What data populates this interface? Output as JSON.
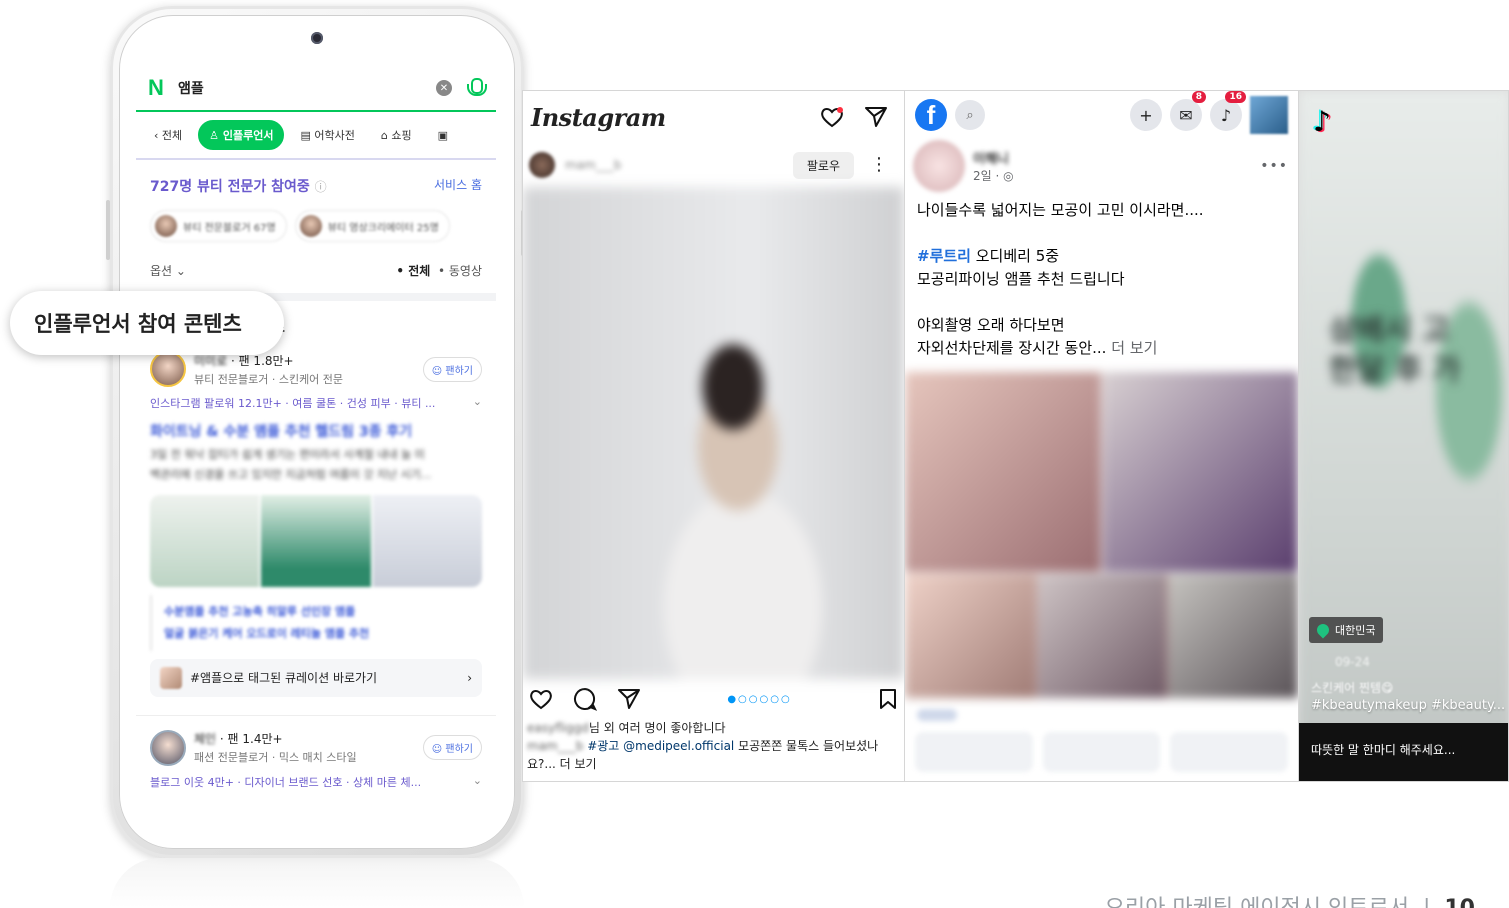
{
  "naver": {
    "query": "앰플",
    "tabs": [
      "전체",
      "인플루언서",
      "어학사전",
      "쇼핑"
    ],
    "stats_title": "727명 뷰티 전문가 참여중",
    "service_home": "서비스 홈",
    "chips": [
      "뷰티 전문블로거 67명",
      "뷰티 영상크리에이터 25명"
    ],
    "options_label": "옵션",
    "filter_all": "• 전체",
    "filter_video": "• 동영상",
    "section_title_suffix": "츠",
    "profile1": {
      "fans": "· 팬 1.8만+",
      "sub": "뷰티 전문블로거 · 스킨케어 전문",
      "fan_button": "☺ 팬하기",
      "tags": "인스타그램 팔로워 12.1만+ · 여름 쿨톤 · 건성 피부 · 뷰티 ..."
    },
    "post_title": "화이트닝 & 수분 앰플 추천 헬드림 3종 후기",
    "post_body": [
      "3일 전 워낙 잡티가 쉽게 생기는 편이라서 사계절 내내 늘 미",
      "백관리에 신경을 쓰고 있지만 지금처럼 여름이 갓 지난 시기..."
    ],
    "related_links": [
      "수분앰플 추천 고농축 히알루 선인장 앰플",
      "얼굴 붉은기 케어 오드로이 레티놀 앰플 추천"
    ],
    "curation": "#앰플으로 태그된 큐레이션 바로가기",
    "profile2": {
      "fans": "· 팬 1.4만+",
      "sub": "패션 전문블로거 · 믹스 매치 스타일",
      "fan_button": "☺ 팬하기",
      "tags": "블로그 이웃 4만+ · 디자이너 브랜드 선호 · 상체 마른 체..."
    }
  },
  "callout": "인플루언서 참여 콘텐츠",
  "instagram": {
    "logo": "Instagram",
    "follow": "팔로우",
    "likes": "님 외 여러 명이 좋아합니다",
    "caption_tag": "#광고 @medipeel.official",
    "caption_text": " 모공쫀쫀 물톡스 들어보셨나",
    "caption_more": "요?... 더 보기"
  },
  "facebook": {
    "time": "2일 · ◎",
    "line1": "나이들수록 넓어지는 모공이 고민 이시라면....",
    "hashtag": "#루트리",
    "line2_rest": " 오디베리 5중",
    "line3": "모공리파이닝 앰플 추천 드립니다",
    "line4": "야외촬영 오래 하다보면",
    "line5": "자외선차단제를 장시간 동안...",
    "see_more": " 더 보기",
    "badge_messenger": "8",
    "badge_notif": "16"
  },
  "tiktok": {
    "location": "대한민국",
    "caption": "#kbeautymakeup #kbeauty...",
    "comment": "따뜻한 말 한마디 해주세요..."
  },
  "colors": {
    "naver_green": "#03c75a",
    "facebook_blue": "#1877f2",
    "instagram_tag": "#00376b"
  }
}
